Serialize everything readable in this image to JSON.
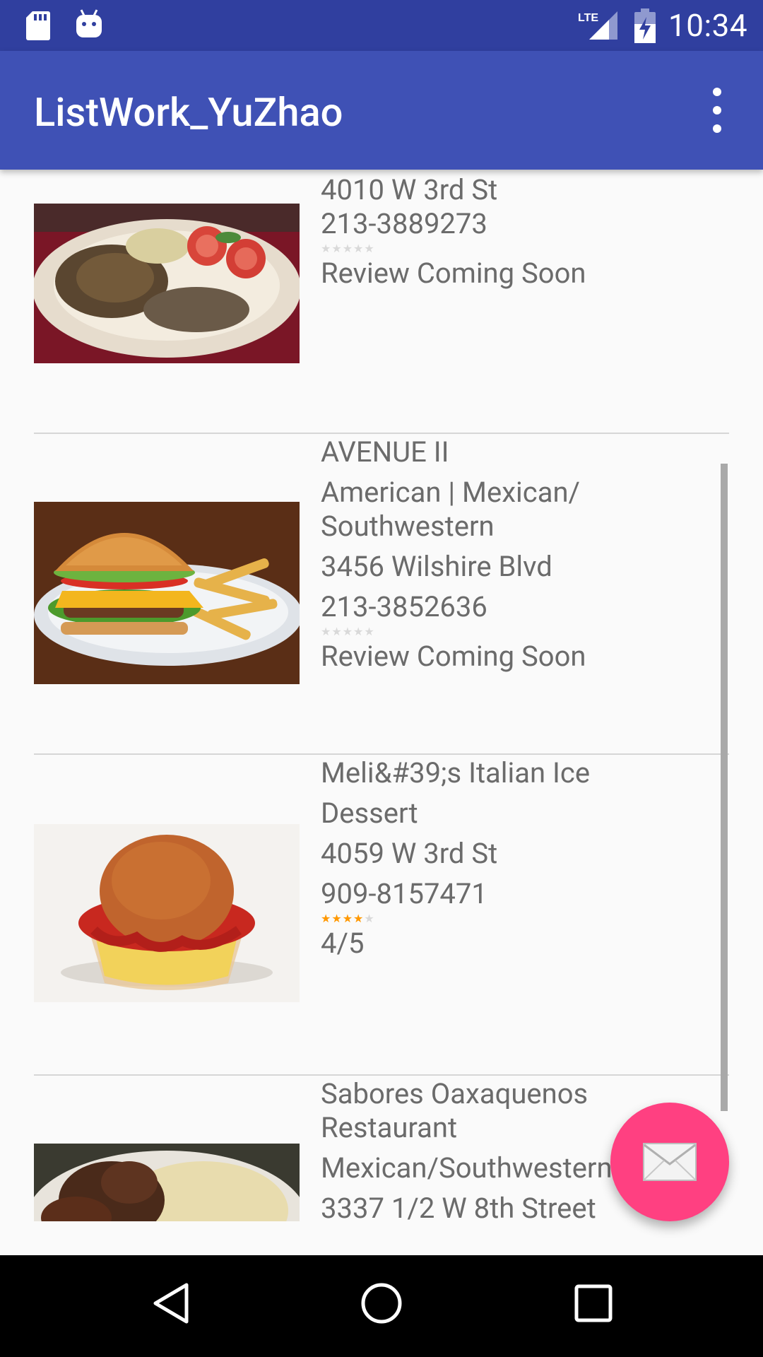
{
  "status_bar": {
    "time": "10:34",
    "icons": [
      "sd-card-icon",
      "android-icon",
      "lte-signal-icon",
      "battery-charging-icon"
    ]
  },
  "app_bar": {
    "title": "ListWork_YuZhao",
    "menu_icon": "overflow-menu-icon"
  },
  "colors": {
    "status_bar": "#303f9f",
    "app_bar": "#3f51b5",
    "fab": "#ff4081",
    "star_on": "#ff9800",
    "star_off": "#d9d9d9"
  },
  "restaurants": [
    {
      "address": "4010 W 3rd St",
      "phone": "213-3889273",
      "rating": 0,
      "review": "Review Coming Soon"
    },
    {
      "name": "AVENUE II",
      "category": "American | Mexican/ Southwestern",
      "address": "3456 Wilshire Blvd",
      "phone": "213-3852636",
      "rating": 0,
      "review": "Review Coming Soon"
    },
    {
      "name": "Meli&#39;s Italian Ice",
      "category": "Dessert",
      "address": "4059 W 3rd St",
      "phone": "909-8157471",
      "rating": 4,
      "review": "4/5"
    },
    {
      "name": "Sabores Oaxaquenos Restaurant",
      "category": "Mexican/Southwestern",
      "address": "3337 1/2 W 8th Street"
    }
  ],
  "fab": {
    "icon": "mail-icon"
  },
  "nav_bar": {
    "icons": [
      "back-icon",
      "home-icon",
      "recents-icon"
    ]
  }
}
